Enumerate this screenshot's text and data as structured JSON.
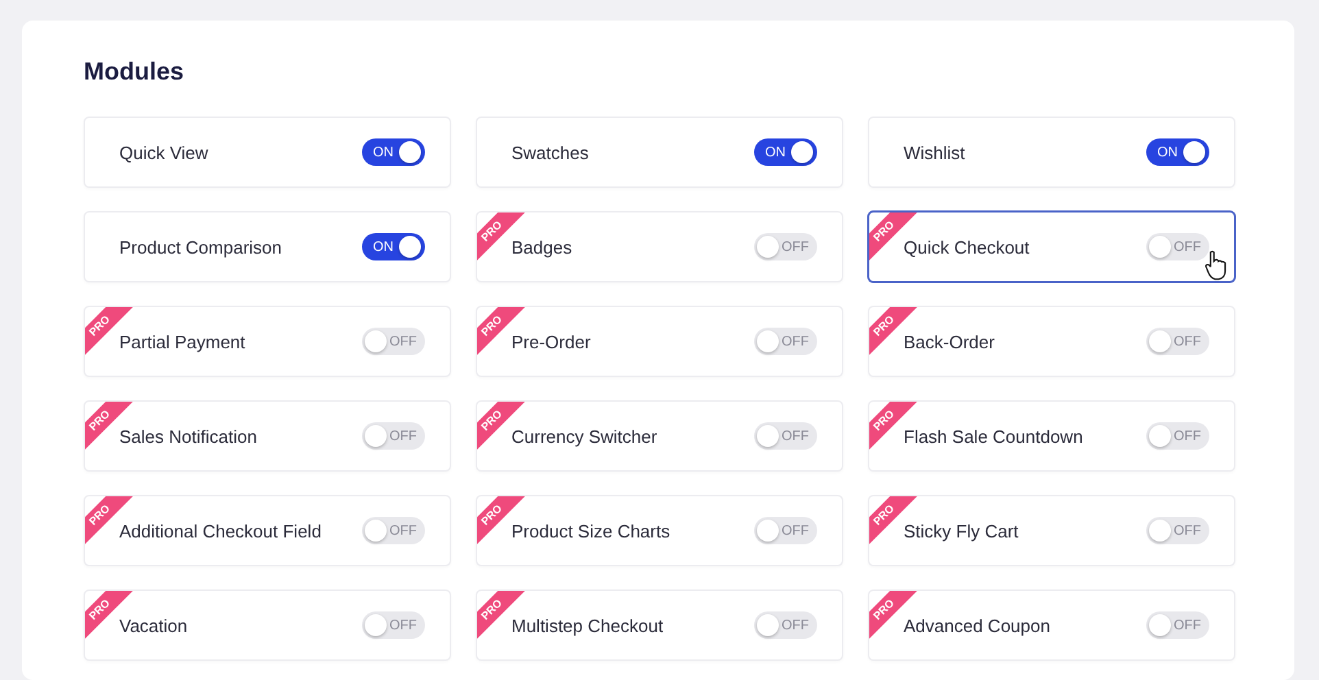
{
  "title": "Modules",
  "modules": [
    {
      "label": "Quick View",
      "on": true,
      "toggle_text": "ON",
      "pro": false,
      "highlighted": false
    },
    {
      "label": "Swatches",
      "on": true,
      "toggle_text": "ON",
      "pro": false,
      "highlighted": false
    },
    {
      "label": "Wishlist",
      "on": true,
      "toggle_text": "ON",
      "pro": false,
      "highlighted": false
    },
    {
      "label": "Product Comparison",
      "on": true,
      "toggle_text": "ON",
      "pro": false,
      "highlighted": false
    },
    {
      "label": "Badges",
      "on": false,
      "toggle_text": "OFF",
      "pro": true,
      "badge": "PRO",
      "highlighted": false
    },
    {
      "label": "Quick Checkout",
      "on": false,
      "toggle_text": "OFF",
      "pro": true,
      "badge": "PRO",
      "highlighted": true
    },
    {
      "label": "Partial Payment",
      "on": false,
      "toggle_text": "OFF",
      "pro": true,
      "badge": "PRO",
      "highlighted": false
    },
    {
      "label": "Pre-Order",
      "on": false,
      "toggle_text": "OFF",
      "pro": true,
      "badge": "PRO",
      "highlighted": false
    },
    {
      "label": "Back-Order",
      "on": false,
      "toggle_text": "OFF",
      "pro": true,
      "badge": "PRO",
      "highlighted": false
    },
    {
      "label": "Sales Notification",
      "on": false,
      "toggle_text": "OFF",
      "pro": true,
      "badge": "PRO",
      "highlighted": false
    },
    {
      "label": "Currency Switcher",
      "on": false,
      "toggle_text": "OFF",
      "pro": true,
      "badge": "PRO",
      "highlighted": false
    },
    {
      "label": "Flash Sale Countdown",
      "on": false,
      "toggle_text": "OFF",
      "pro": true,
      "badge": "PRO",
      "highlighted": false
    },
    {
      "label": "Additional Checkout Field",
      "on": false,
      "toggle_text": "OFF",
      "pro": true,
      "badge": "PRO",
      "highlighted": false
    },
    {
      "label": "Product Size Charts",
      "on": false,
      "toggle_text": "OFF",
      "pro": true,
      "badge": "PRO",
      "highlighted": false
    },
    {
      "label": "Sticky Fly Cart",
      "on": false,
      "toggle_text": "OFF",
      "pro": true,
      "badge": "PRO",
      "highlighted": false
    },
    {
      "label": "Vacation",
      "on": false,
      "toggle_text": "OFF",
      "pro": true,
      "badge": "PRO",
      "highlighted": false
    },
    {
      "label": "Multistep Checkout",
      "on": false,
      "toggle_text": "OFF",
      "pro": true,
      "badge": "PRO",
      "highlighted": false
    },
    {
      "label": "Advanced Coupon",
      "on": false,
      "toggle_text": "OFF",
      "pro": true,
      "badge": "PRO",
      "highlighted": false
    }
  ]
}
